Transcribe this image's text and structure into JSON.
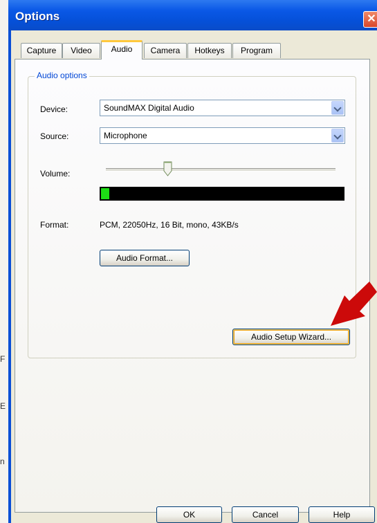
{
  "window": {
    "title": "Options",
    "close_glyph": "✕"
  },
  "tabs": [
    {
      "label": "Capture",
      "active": false
    },
    {
      "label": "Video",
      "active": false
    },
    {
      "label": "Audio",
      "active": true
    },
    {
      "label": "Camera",
      "active": false
    },
    {
      "label": "Hotkeys",
      "active": false
    },
    {
      "label": "Program",
      "active": false
    }
  ],
  "audio": {
    "group_title": "Audio options",
    "device_label": "Device:",
    "device_value": "SoundMAX Digital Audio",
    "source_label": "Source:",
    "source_value": "Microphone",
    "volume_label": "Volume:",
    "volume_level": 0.22,
    "meter_level": 0.035,
    "meter_color": "#1dde15",
    "format_label": "Format:",
    "format_value": "PCM, 22050Hz, 16 Bit, mono, 43KB/s",
    "format_button": "Audio Format...",
    "wizard_button": "Audio Setup Wizard..."
  },
  "footer": {
    "ok": "OK",
    "cancel": "Cancel",
    "help": "Help"
  },
  "annotation": {
    "icon": "red-arrow-icon",
    "color": "#cc0a0a"
  },
  "backdrop": {
    "marks": [
      "F",
      "E",
      "n"
    ]
  }
}
